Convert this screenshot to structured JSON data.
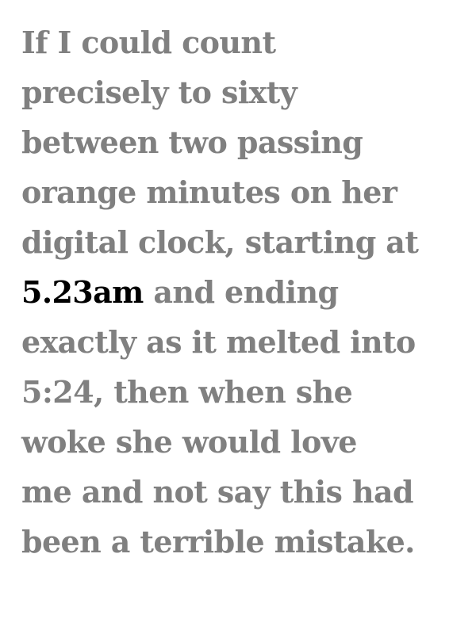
{
  "colors": {
    "text": "#808080",
    "highlight": "#000000",
    "background": "#ffffff"
  },
  "quote": {
    "lines": [
      "If I could count",
      "precisely to sixty",
      "between two passing",
      "orange minutes on her",
      "digital clock, starting at"
    ],
    "highlight": "5.23am",
    "highlight_tail": " and ending",
    "lines_after": [
      "exactly as it melted into",
      "5:24, then when she",
      "woke she would love",
      "me and not say this had",
      "been a terrible mistake."
    ]
  }
}
